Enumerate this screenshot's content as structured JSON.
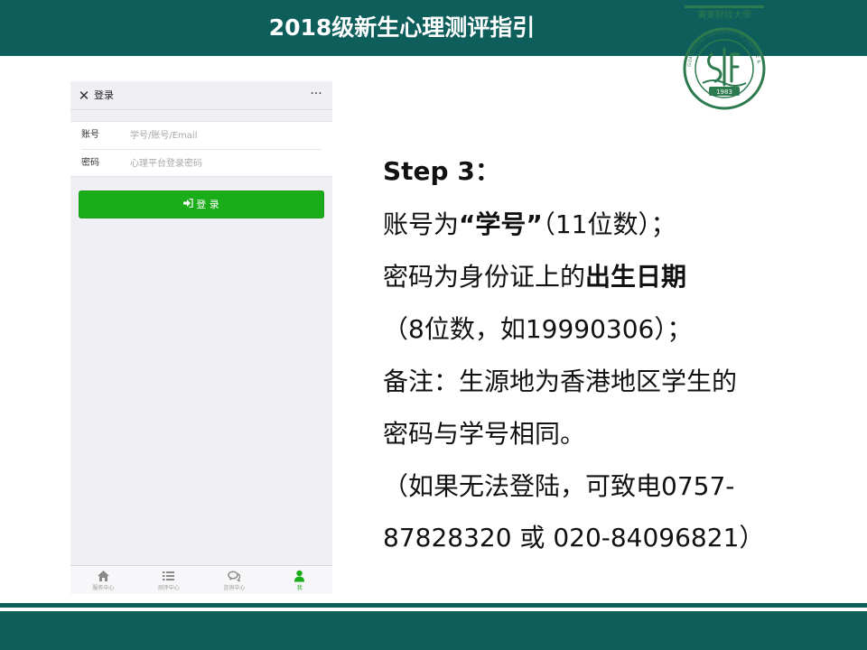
{
  "slide": {
    "title": "2018级新生心理测评指引",
    "colors": {
      "teal": "#0e5e5c",
      "green": "#1aac19"
    }
  },
  "logo": {
    "arc_text": "廣東財經大學",
    "ring_text": "GUANGDONG UNIVERSITY OF FINANCE & ECONOMICS",
    "year": "1983"
  },
  "phone": {
    "nav": {
      "close_icon": "close-icon",
      "title": "登录",
      "more_icon": "ellipsis-icon"
    },
    "form": {
      "account_label": "账号",
      "account_placeholder": "学号/账号/Email",
      "password_label": "密码",
      "password_placeholder": "心理平台登录密码"
    },
    "login_button": {
      "icon": "sign-in-icon",
      "label": "登 录"
    },
    "tabs": [
      {
        "label": "服务中心",
        "icon": "home-icon",
        "active": false
      },
      {
        "label": "测评中心",
        "icon": "list-icon",
        "active": false
      },
      {
        "label": "咨询中心",
        "icon": "chat-icon",
        "active": false
      },
      {
        "label": "我",
        "icon": "user-icon",
        "active": true
      }
    ]
  },
  "instructions": {
    "step": "Step 3：",
    "line1_a": "账号为",
    "line1_b": "“学号”",
    "line1_c": "（11位数）；",
    "line2_a": "密码为身份证上的",
    "line2_b": "出生日期",
    "line3": "（8位数，如19990306）；",
    "line4": "备注：生源地为香港地区学生的",
    "line5": "密码与学号相同。",
    "line6": "（如果无法登陆，可致电0757-",
    "line7": "87828320 或 020-84096821）"
  }
}
